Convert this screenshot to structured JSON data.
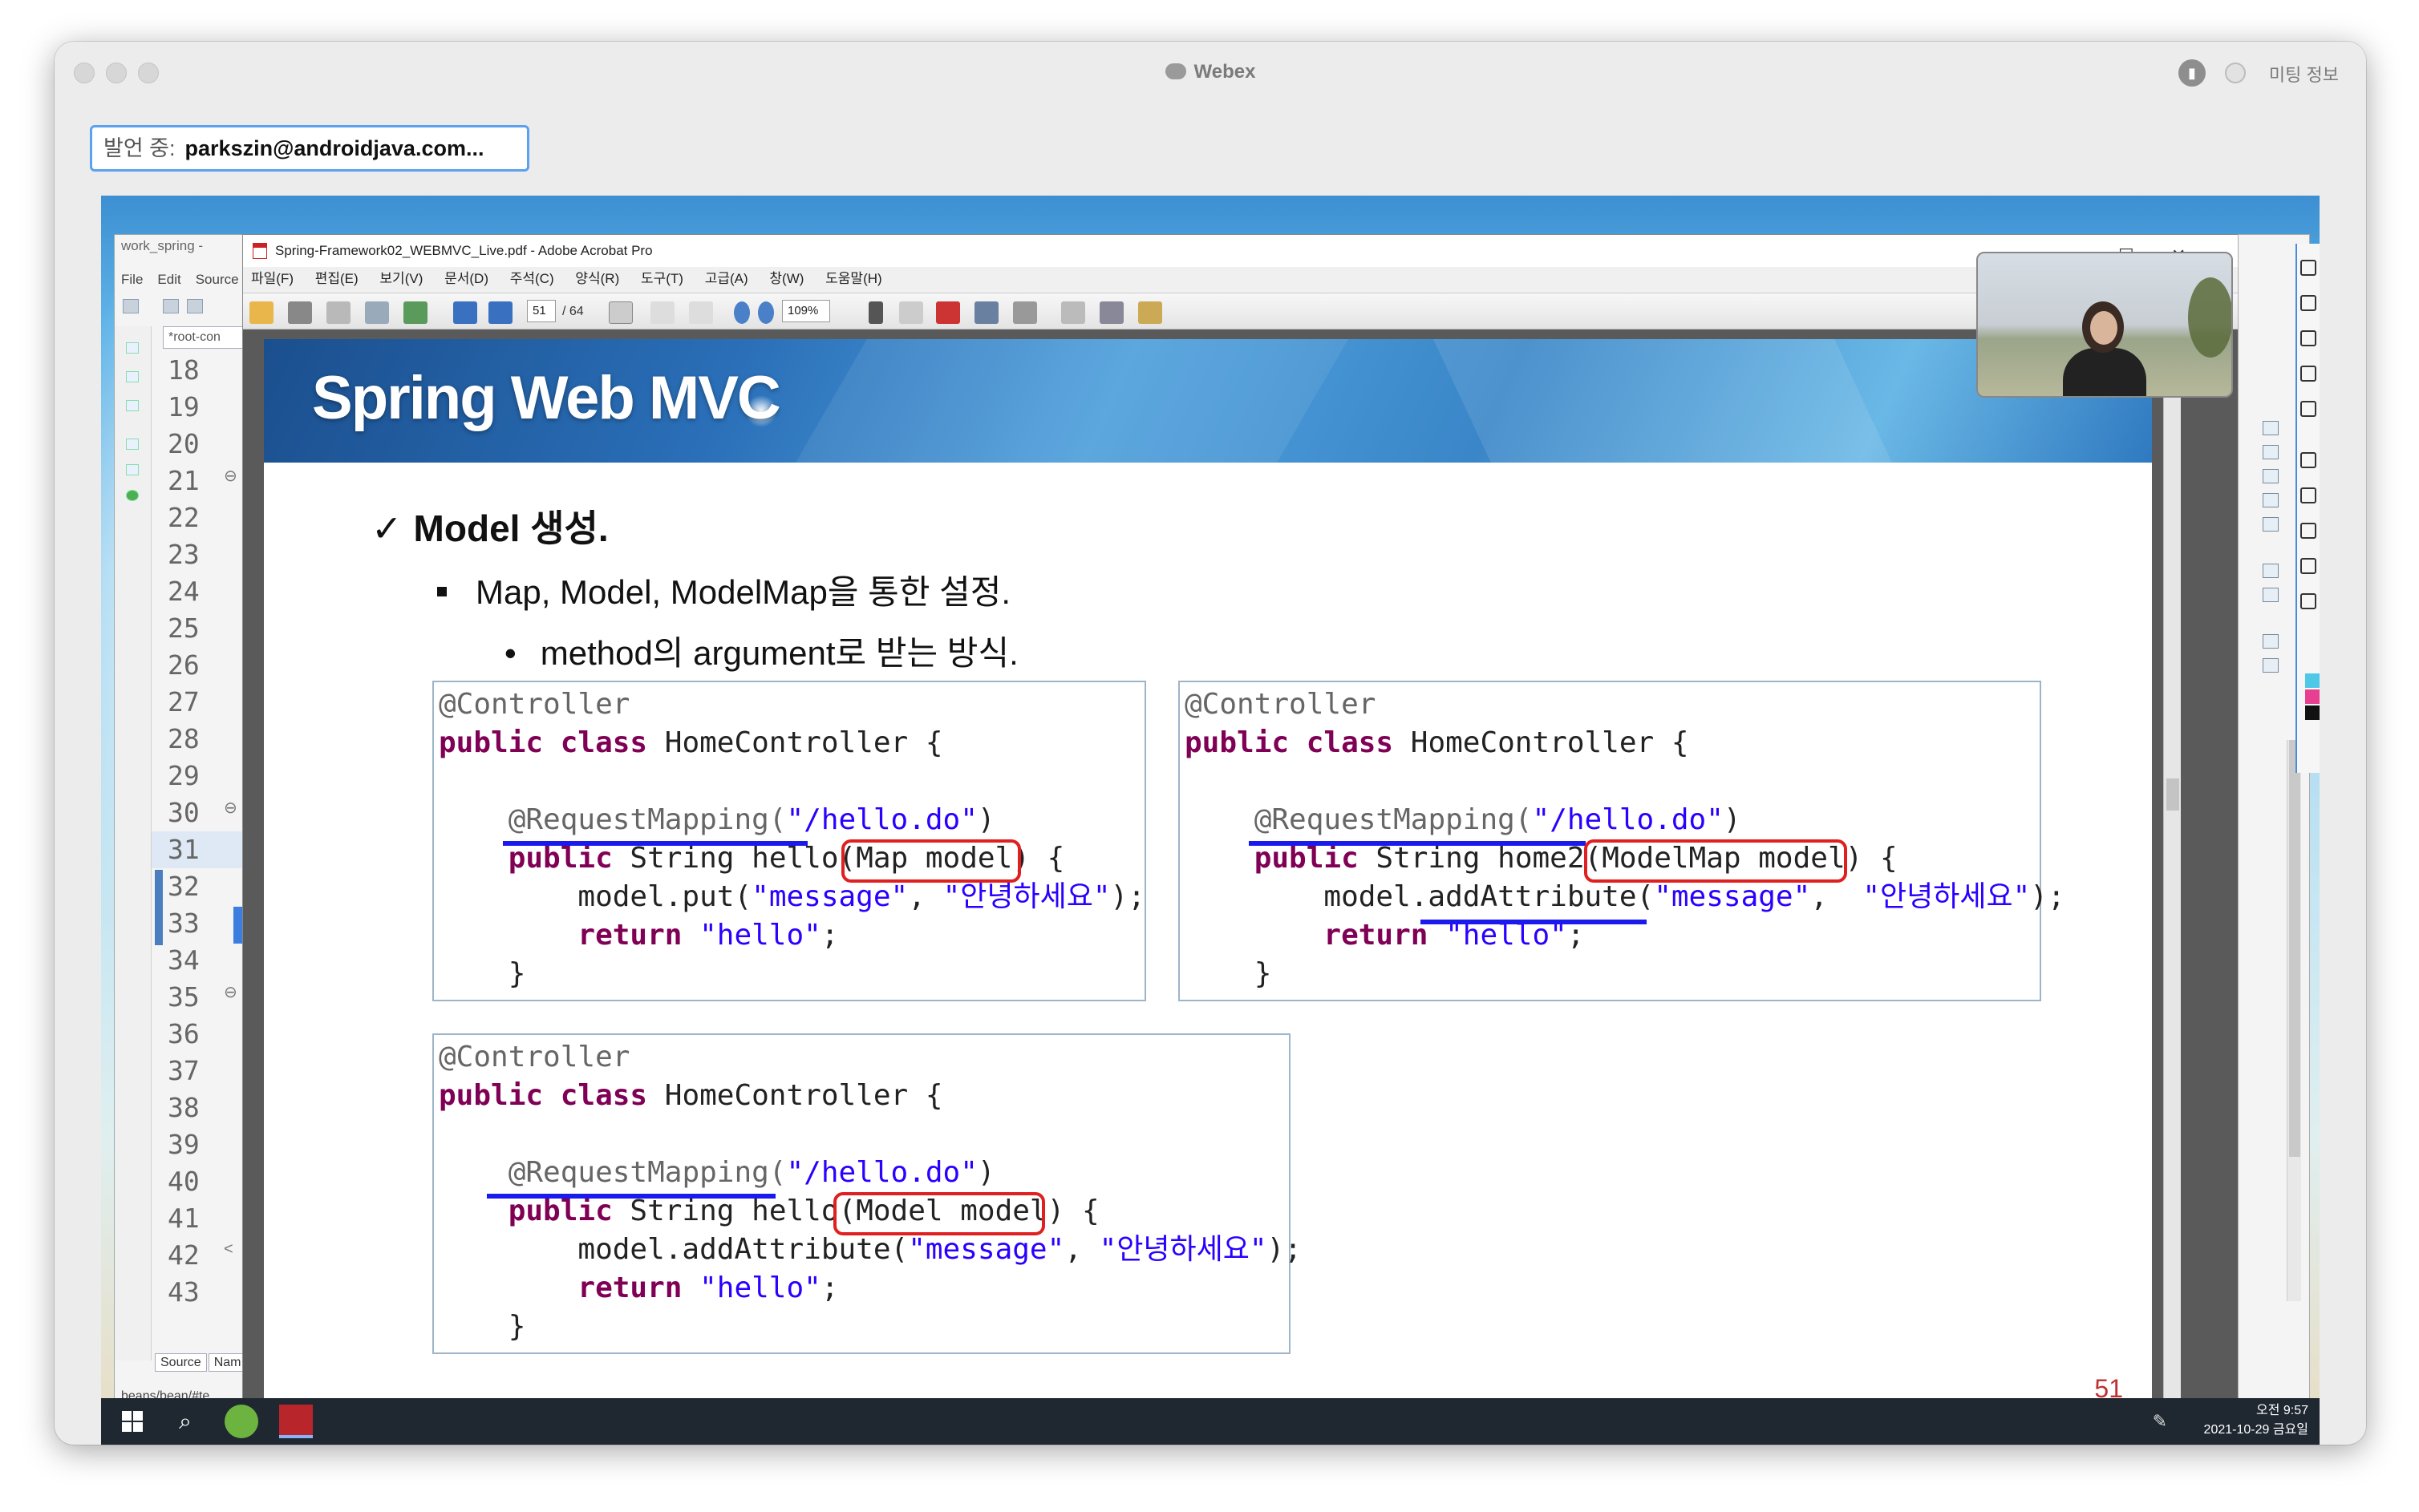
{
  "window": {
    "app_title": "Webex",
    "meeting_info_label": "미팅 정보"
  },
  "speaker": {
    "label": "발언 중:",
    "name": "parkszin@androidjava.com..."
  },
  "eclipse": {
    "title": "work_spring - ",
    "menu": [
      "File",
      "Edit",
      "Source"
    ],
    "tab_label": "*root-con",
    "line_numbers": [
      "18",
      "19",
      "20",
      "21",
      "22",
      "23",
      "24",
      "25",
      "26",
      "27",
      "28",
      "29",
      "30",
      "31",
      "32",
      "33",
      "34",
      "35",
      "36",
      "37",
      "38",
      "39",
      "40",
      "41",
      "42",
      "43"
    ],
    "line_markers": {
      "21": "⊖",
      "30": "⊖",
      "35": "⊖",
      "42": "<"
    },
    "bottom_tabs": [
      "Source",
      "Nam"
    ],
    "status_path": "beans/bean/#te"
  },
  "acrobat": {
    "title": "Spring-Framework02_WEBMVC_Live.pdf - Adobe Acrobat Pro",
    "menu": [
      "파일(F)",
      "편집(E)",
      "보기(V)",
      "문서(D)",
      "주석(C)",
      "양식(R)",
      "도구(T)",
      "고급(A)",
      "창(W)",
      "도움말(H)"
    ],
    "page_current": "51",
    "page_total": "/ 64",
    "zoom": "109%"
  },
  "slide": {
    "title": "Spring Web MVC",
    "bullet1": "Model 생성.",
    "bullet1_mark": "✓",
    "bullet2": "Map, Model, ModelMap을 통한 설정.",
    "bullet3": "method의 argument로 받는 방식.",
    "bullet3_mark": "•",
    "page_number": "51",
    "code_blocks": [
      {
        "annotation": "@Controller",
        "class_kw": "public class",
        "class_name": " HomeController {",
        "mapping_ann": "@RequestMapping(",
        "mapping_path": "\"/hello.do\"",
        "mapping_close": ")",
        "method_kw": "public",
        "method_sig": " String hello",
        "param": "(Map model)",
        "method_open": " {",
        "body1_pre": "model.put(",
        "body1_k": "\"message\"",
        "body1_sep": ", ",
        "body1_v": "\"안녕하세요\"",
        "body1_end": ");",
        "ret_kw": "return",
        "ret_val": " \"hello\"",
        "ret_end": ";",
        "close": "}"
      },
      {
        "annotation": "@Controller",
        "class_kw": "public class",
        "class_name": " HomeController {",
        "mapping_ann": "@RequestMapping(",
        "mapping_path": "\"/hello.do\"",
        "mapping_close": ")",
        "method_kw": "public",
        "method_sig": " String home2",
        "param": "(ModelMap model)",
        "method_open": " {",
        "body1_pre": "model.addAttribute(",
        "body1_k": "\"message\"",
        "body1_sep": ",  ",
        "body1_v": "\"안녕하세요\"",
        "body1_end": ");",
        "ret_kw": "return",
        "ret_val": " \"hello\"",
        "ret_end": ";",
        "close": "}"
      },
      {
        "annotation": "@Controller",
        "class_kw": "public class",
        "class_name": " HomeController {",
        "mapping_ann": "@RequestMapping(",
        "mapping_path": "\"/hello.do\"",
        "mapping_close": ")",
        "method_kw": "public",
        "method_sig": " String hello",
        "param": "(Model model)",
        "method_open": " {",
        "body1_pre": "model.addAttribute(",
        "body1_k": "\"message\"",
        "body1_sep": ", ",
        "body1_v": "\"안녕하세요\"",
        "body1_end": ");",
        "ret_kw": "return",
        "ret_val": " \"hello\"",
        "ret_end": ";",
        "close": "}"
      }
    ]
  },
  "taskbar": {
    "time": "오전 9:57",
    "date": "2021-10-29 금요일"
  },
  "colors": {
    "keyword": "#7f0055",
    "string": "#2a00ff",
    "highlight_red": "#e02020",
    "underline_blue": "#1a1aee"
  }
}
